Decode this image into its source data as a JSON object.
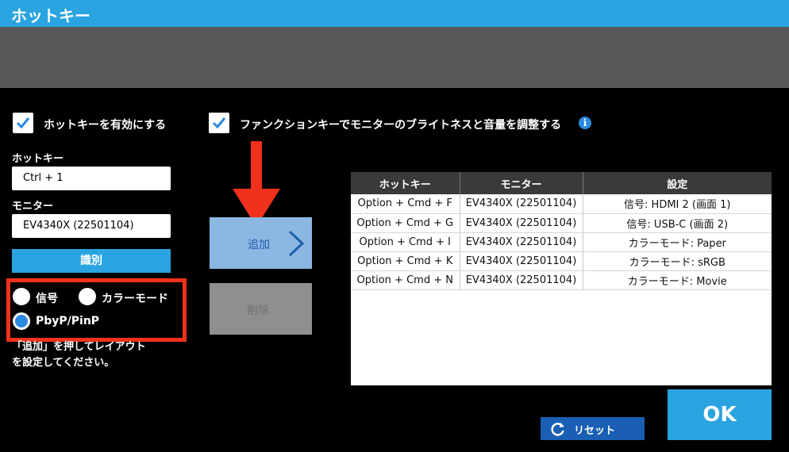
{
  "window": {
    "title": "ホットキー"
  },
  "options": {
    "enable_hotkey_label": "ホットキーを有効にする",
    "enable_hotkey_checked": true,
    "function_key_label": "ファンクションキーでモニターのブライトネスと音量を調整する",
    "function_key_checked": true
  },
  "form": {
    "hotkey_label": "ホットキー",
    "hotkey_value": "Ctrl + 1",
    "monitor_label": "モニター",
    "monitor_value": "EV4340X (22501104)",
    "identify_label": "識別"
  },
  "layout_options": {
    "items": [
      {
        "label": "信号",
        "selected": false
      },
      {
        "label": "カラーモード",
        "selected": false
      },
      {
        "label": "PbyP/PinP",
        "selected": true
      }
    ],
    "note_line1": "「追加」を押してレイアウト",
    "note_line2": "を設定してください。"
  },
  "actions": {
    "add_label": "追加",
    "delete_label": "削除"
  },
  "table": {
    "headers": [
      "ホットキー",
      "モニター",
      "設定"
    ],
    "rows": [
      [
        "Option + Cmd + F",
        "EV4340X (22501104)",
        "信号: HDMI 2 (画面 1)"
      ],
      [
        "Option + Cmd + G",
        "EV4340X (22501104)",
        "信号: USB-C (画面 2)"
      ],
      [
        "Option + Cmd + I",
        "EV4340X (22501104)",
        "カラーモード: Paper"
      ],
      [
        "Option + Cmd + K",
        "EV4340X (22501104)",
        "カラーモード: sRGB"
      ],
      [
        "Option + Cmd + N",
        "EV4340X (22501104)",
        "カラーモード: Movie"
      ]
    ]
  },
  "footer": {
    "reset_label": "リセット",
    "ok_label": "OK"
  },
  "icons": {
    "checkmark": "checkmark-icon",
    "info": "info-icon",
    "chevron": "chevron-right-icon",
    "reset": "refresh-icon",
    "annotation": "red-arrow-down"
  },
  "colors": {
    "accent": "#2aa4e0",
    "highlight_red": "#f0321c",
    "add_button": "#8bb7e3",
    "reset_button": "#1a5fb4"
  }
}
